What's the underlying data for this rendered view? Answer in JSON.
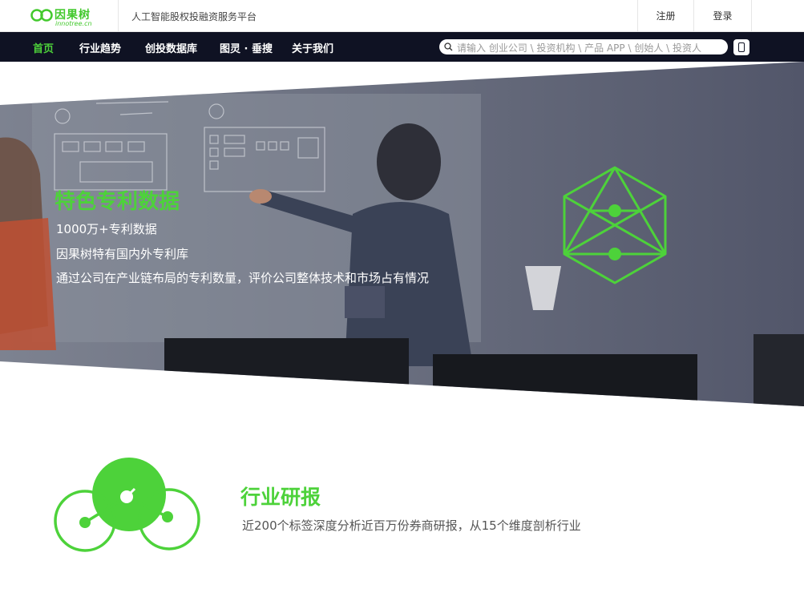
{
  "header": {
    "logo_cn": "因果树",
    "logo_en": "innotree.cn",
    "tagline": "人工智能股权投融资服务平台",
    "register_label": "注册",
    "login_label": "登录"
  },
  "nav": {
    "items": [
      {
        "label": "首页"
      },
      {
        "label": "行业趋势"
      },
      {
        "label": "创投数据库"
      },
      {
        "label": "图灵 · 垂搜"
      },
      {
        "label": "关于我们"
      }
    ],
    "search_placeholder": "请输入 创业公司 \\ 投资机构 \\ 产品 APP \\ 创始人 \\ 投资人"
  },
  "hero": {
    "title": "特色专利数据",
    "lines": [
      "1000万+专利数据",
      "因果树特有国内外专利库",
      "通过公司在产业链布局的专利数量，评价公司整体技术和市场占有情况"
    ]
  },
  "report": {
    "title": "行业研报",
    "desc": "近200个标签深度分析近百万份券商研报，从15个维度剖析行业"
  },
  "colors": {
    "accent": "#4dd23a",
    "nav_bg": "#0f1223"
  }
}
